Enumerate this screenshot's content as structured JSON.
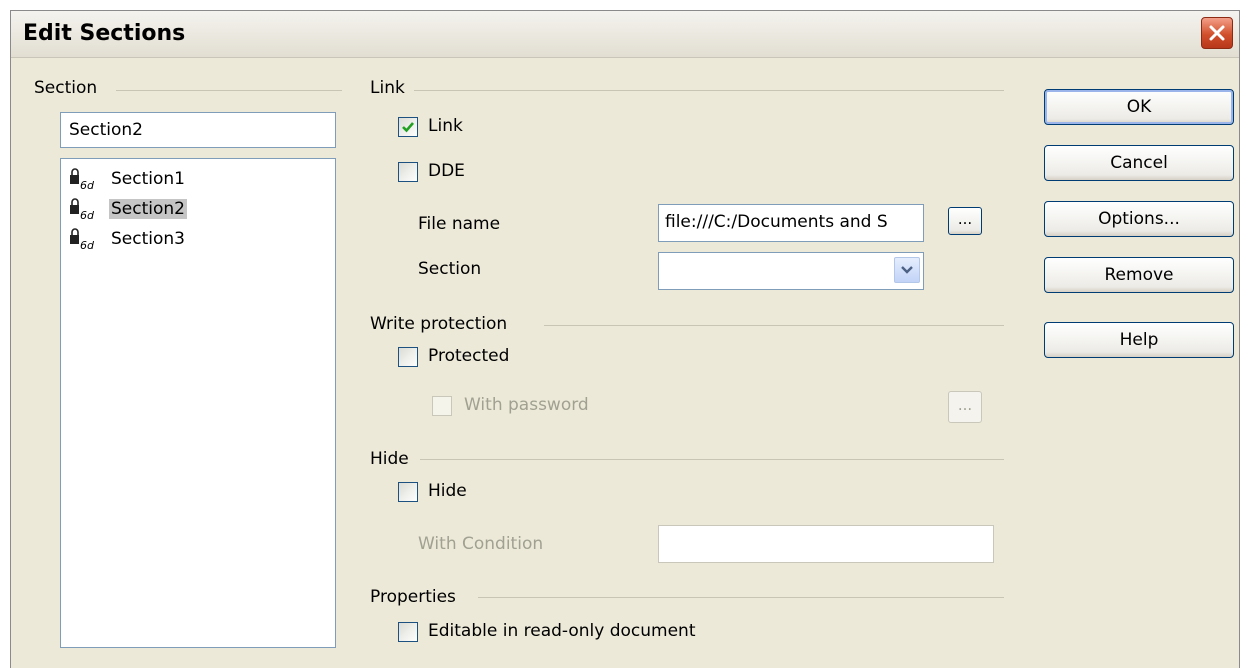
{
  "window": {
    "title": "Edit Sections"
  },
  "section_group": {
    "label": "Section",
    "name_value": "Section2",
    "items": [
      {
        "label": "Section1",
        "icon": "locked-link-icon",
        "selected": false
      },
      {
        "label": "Section2",
        "icon": "locked-link-icon",
        "selected": true
      },
      {
        "label": "Section3",
        "icon": "locked-link-icon",
        "selected": false
      }
    ]
  },
  "link_group": {
    "label": "Link",
    "link_checkbox": {
      "label": "Link",
      "checked": true
    },
    "dde_checkbox": {
      "label": "DDE",
      "checked": false
    },
    "file_name_label": "File name",
    "file_name_value": "file:///C:/Documents and S",
    "browse_label": "...",
    "section_label": "Section",
    "section_value": ""
  },
  "write_protection_group": {
    "label": "Write protection",
    "protected_checkbox": {
      "label": "Protected",
      "checked": false
    },
    "password_checkbox": {
      "label": "With password",
      "checked": false,
      "enabled": false
    },
    "password_button_label": "..."
  },
  "hide_group": {
    "label": "Hide",
    "hide_checkbox": {
      "label": "Hide",
      "checked": false
    },
    "condition_label": "With Condition",
    "condition_value": ""
  },
  "properties_group": {
    "label": "Properties",
    "editable_checkbox": {
      "label": "Editable in read-only document",
      "checked": false
    }
  },
  "buttons": {
    "ok": "OK",
    "cancel": "Cancel",
    "options": "Options...",
    "remove": "Remove",
    "help": "Help"
  }
}
